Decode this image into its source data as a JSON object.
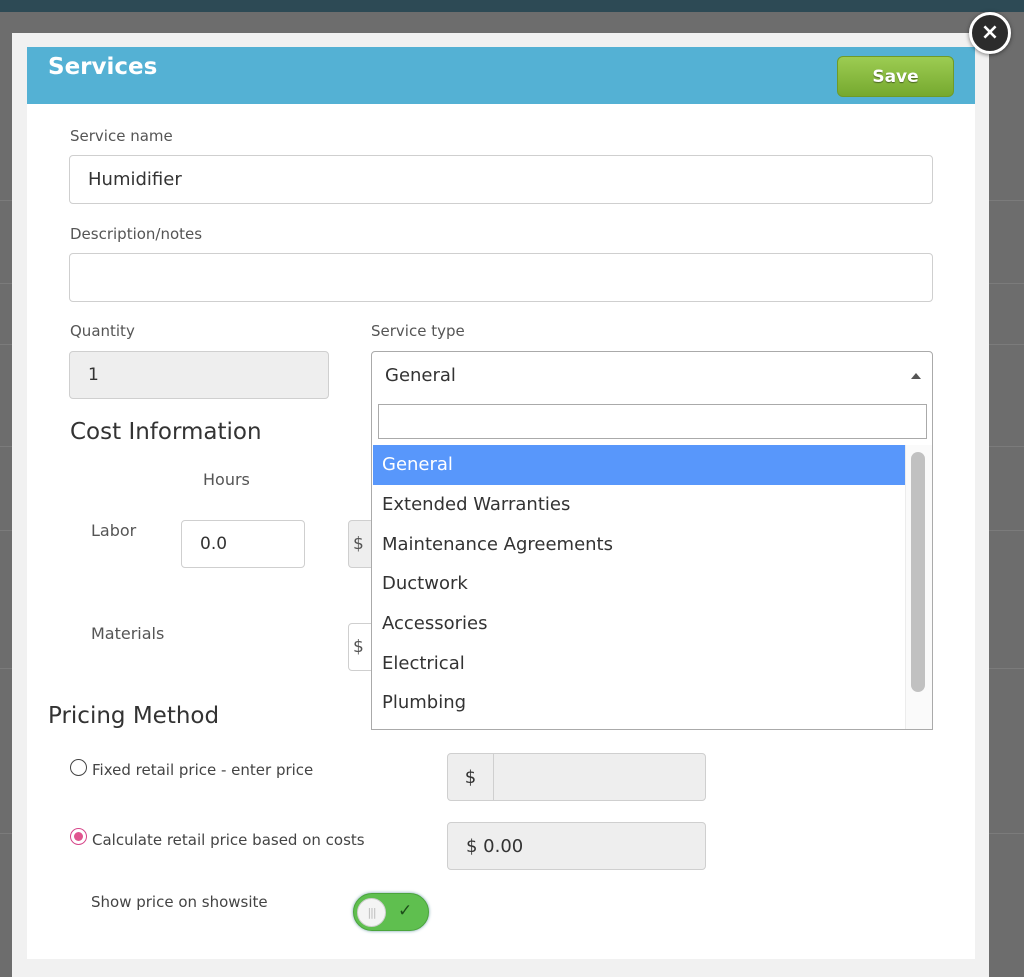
{
  "colors": {
    "header_bg": "#54b1d4",
    "save_button": "#8bbd42",
    "selected_option": "#5897fb",
    "radio_checked": "#e0558f",
    "toggle_on": "#5fbf4f"
  },
  "icons": {
    "close": "close-icon",
    "dropdown_arrow": "caret-up-icon",
    "toggle_check": "checkmark-icon"
  },
  "header": {
    "title": "Services",
    "save_label": "Save",
    "close_glyph": "×"
  },
  "form": {
    "service_name_label": "Service name",
    "service_name_value": "Humidifier",
    "description_label": "Description/notes",
    "description_value": "",
    "quantity_label": "Quantity",
    "quantity_value": "1",
    "service_type_label": "Service type",
    "service_type_value": "General"
  },
  "service_type_dropdown": {
    "search_value": "",
    "options": [
      "General",
      "Extended Warranties",
      "Maintenance Agreements",
      "Ductwork",
      "Accessories",
      "Electrical",
      "Plumbing"
    ],
    "selected_index": 0
  },
  "cost": {
    "heading": "Cost Information",
    "hours_header": "Hours",
    "labor_label": "Labor",
    "labor_hours": "0.0",
    "labor_cost_partial": "$",
    "materials_label": "Materials",
    "materials_cost_partial": "$"
  },
  "pricing": {
    "heading": "Pricing Method",
    "fixed_label": "Fixed retail price - enter price",
    "fixed_currency": "$",
    "fixed_value": "",
    "calc_label": "Calculate retail price based on costs",
    "calc_value": "$ 0.00",
    "selected": "calc",
    "showsite_label": "Show price on showsite",
    "showsite_on": true,
    "toggle_check": "✓"
  }
}
